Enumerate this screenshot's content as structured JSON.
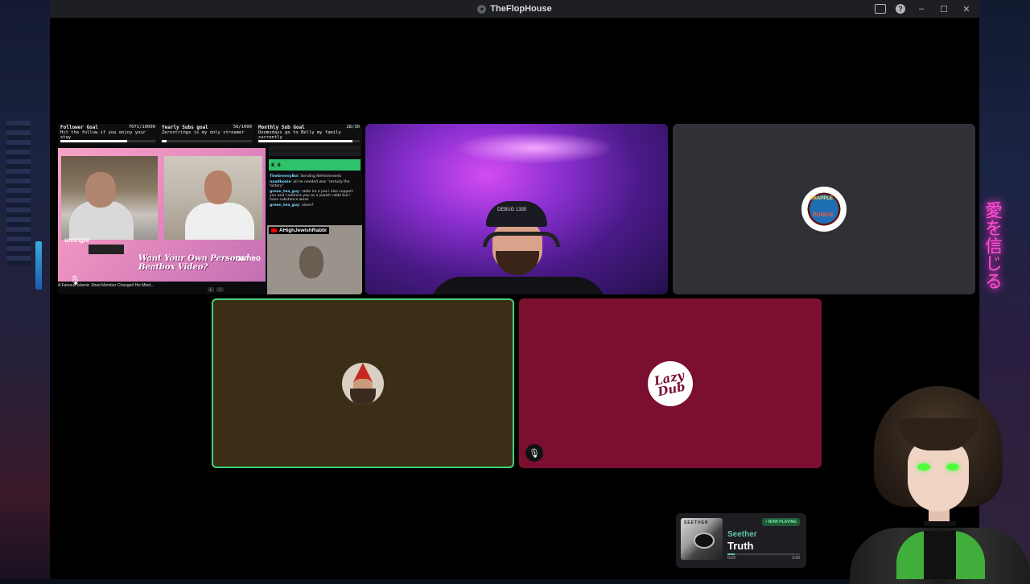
{
  "window": {
    "title": "TheFlopHouse",
    "icons": [
      "server-icon",
      "inbox-icon",
      "help-icon",
      "minimize-icon",
      "maximize-icon",
      "close-icon"
    ],
    "controls": {
      "minimize": "–",
      "maximize": "☐",
      "close": "✕",
      "help": "?"
    }
  },
  "background": {
    "neon_sign": "愛を信じる"
  },
  "screen_share": {
    "goals": [
      {
        "title": "Follower Goal",
        "desc": "Hit the follow if you enjoy your stay",
        "count": "7071/10000",
        "progress": 0.7071
      },
      {
        "title": "Yearly Subs goal",
        "desc": "Zerostrings is my only streamer",
        "count": "56/1000",
        "progress": 0.056
      },
      {
        "title": "Monthly Sub Goal",
        "desc": "Doomsdays go to Belly my family currently",
        "count": "28/30",
        "progress": 0.93
      }
    ],
    "webcam_brand": "umingle",
    "ad_text": "Want Your Own Personal Beatbox Video?",
    "ad_brand": "cameo",
    "video_title": "A Famous Islamic Jihad Member Changed His Mind...",
    "chat": {
      "kick_count": "6",
      "lines": [
        {
          "user": "TheGreenyBoi",
          "text": "Sending Refreshments"
        },
        {
          "user": "naadboaie",
          "text": "all he needed was \"restudy the history\""
        },
        {
          "user": "green_tea_guy",
          "text": "rabbi im a jew i also support you and i address you as a jewish rabbi but i have substance woze"
        },
        {
          "user": "green_tea_guy",
          "text": "alone?"
        }
      ]
    },
    "guest_cam_label": "AHighJewishRabbi"
  },
  "tiles": {
    "streamer_cap_text": "DEBUG 1330",
    "game_avatar_text_top": "GRAPPLE",
    "game_avatar_text_bottom": "PUNCH",
    "speaking_tile_color": "#43d37b",
    "lazy_dub_text": "Lazy Dub"
  },
  "now_playing": {
    "badge": "• NOW PLAYING",
    "artist": "Seether",
    "song": "Truth",
    "album_label": "SEETHER",
    "elapsed": "0:23",
    "duration": "3:50",
    "progress": 0.1
  }
}
